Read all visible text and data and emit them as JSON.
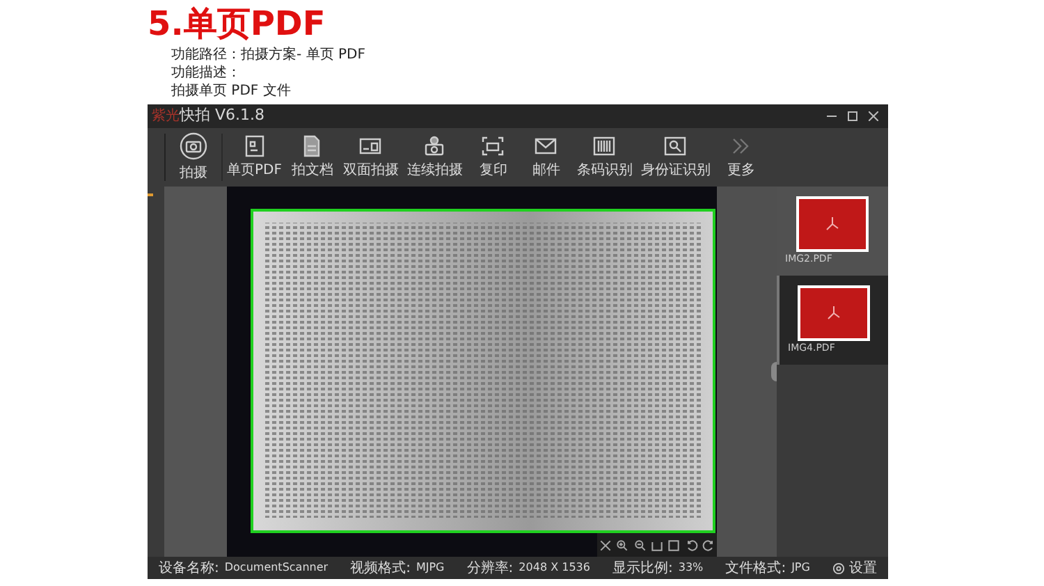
{
  "heading": "5.单页PDF",
  "description": [
    "功能路径：拍摄方案- 单页 PDF",
    "功能描述：",
    "拍摄单页 PDF 文件"
  ],
  "window": {
    "brand": "紫光",
    "title": "快拍 V6.1.8"
  },
  "toolbar": [
    {
      "label": "拍摄",
      "kind": "camera"
    },
    {
      "label": "单页PDF",
      "kind": "pdf"
    },
    {
      "label": "拍文档",
      "kind": "document"
    },
    {
      "label": "双面拍摄",
      "kind": "duplex"
    },
    {
      "label": "连续拍摄",
      "kind": "continuous"
    },
    {
      "label": "复印",
      "kind": "copy"
    },
    {
      "label": "邮件",
      "kind": "mail"
    },
    {
      "label": "条码识别",
      "kind": "barcode"
    },
    {
      "label": "身份证识别",
      "kind": "idcard"
    },
    {
      "label": "更多",
      "kind": "more"
    }
  ],
  "thumbnails": [
    {
      "label": "IMG2.PDF",
      "selected": false
    },
    {
      "label": "IMG4.PDF",
      "selected": true
    }
  ],
  "status_bar": [
    {
      "label": "设备名称:",
      "value": "DocumentScanner"
    },
    {
      "label": "视频格式:",
      "value": "MJPG"
    },
    {
      "label": "分辨率:",
      "value": "2048 X 1536"
    },
    {
      "label": "显示比例:",
      "value": "33%"
    },
    {
      "label": "文件格式:",
      "value": "JPG"
    }
  ],
  "settings": "设置"
}
